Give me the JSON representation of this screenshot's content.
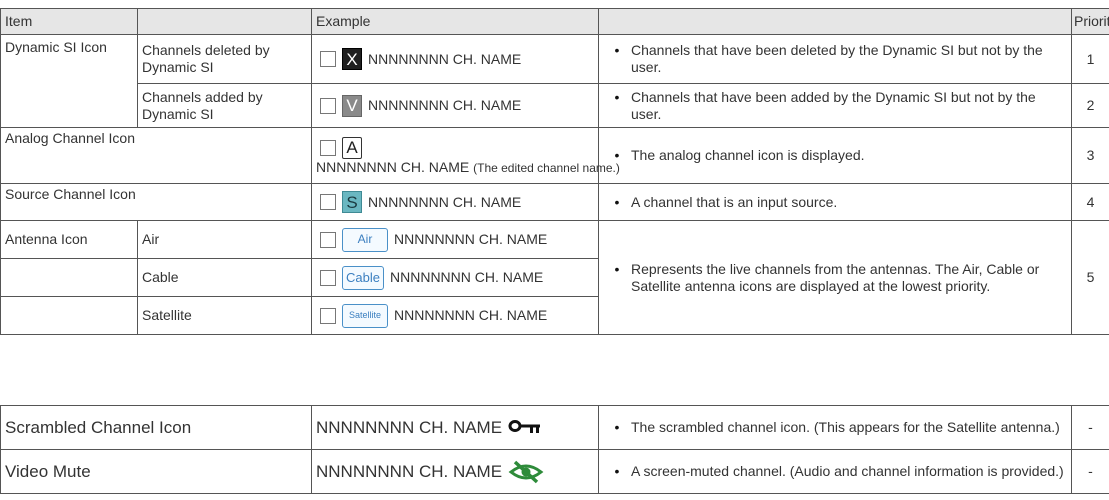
{
  "header": {
    "item": "Item",
    "example": "Example",
    "priority": "Priority"
  },
  "rows": {
    "dynamic_si": {
      "label": "Dynamic SI Icon",
      "deleted": {
        "sub": "Channels deleted by Dynamic SI",
        "icon_letter": "X",
        "example_text": "NNNNNNNN CH. NAME",
        "desc": "Channels that have been deleted by the Dynamic SI but not by the user.",
        "priority": "1"
      },
      "added": {
        "sub": "Channels added by Dynamic SI",
        "icon_letter": "V",
        "example_text": "NNNNNNNN CH. NAME",
        "desc": "Channels that have been added by the Dynamic SI but not by the user.",
        "priority": "2"
      }
    },
    "analog": {
      "label": "Analog Channel Icon",
      "icon_letter": "A",
      "example_text": "NNNNNNNN CH. NAME",
      "example_note": "(The edited channel name.)",
      "desc": "The analog channel icon is displayed.",
      "priority": "3"
    },
    "source": {
      "label": "Source Channel Icon",
      "icon_letter": "S",
      "example_text": "NNNNNNNN CH. NAME",
      "desc": "A channel that is an input source.",
      "priority": "4"
    },
    "antenna": {
      "label": "Antenna Icon",
      "air": {
        "sub": "Air",
        "icon_text": "Air",
        "example_text": "NNNNNNNN CH. NAME"
      },
      "cable": {
        "sub": "Cable",
        "icon_text": "Cable",
        "example_text": "NNNNNNNN CH. NAME"
      },
      "satellite": {
        "sub": "Satellite",
        "icon_text": "Satellite",
        "example_text": "NNNNNNNN CH. NAME"
      },
      "desc": "Represents the live channels from the antennas. The Air, Cable or Satellite antenna icons are displayed at the lowest priority.",
      "priority": "5"
    }
  },
  "extra_rows": {
    "scrambled": {
      "label": "Scrambled Channel Icon",
      "example_text": "NNNNNNNN CH. NAME",
      "icon": "key-icon",
      "desc": "The scrambled channel icon. (This appears for the Satellite antenna.)",
      "priority": "-"
    },
    "video_mute": {
      "label": "Video Mute",
      "example_text": "NNNNNNNN CH. NAME",
      "icon": "eye-slash-icon",
      "desc": "A screen-muted channel. (Audio and channel information is provided.)",
      "priority": "-"
    }
  },
  "bullet": "•",
  "colors": {
    "header_bg": "#e6e6e6",
    "source_icon": "#6ab7c1",
    "antenna_icon": "#4a90c8",
    "mute_icon": "#2e8b3a"
  }
}
